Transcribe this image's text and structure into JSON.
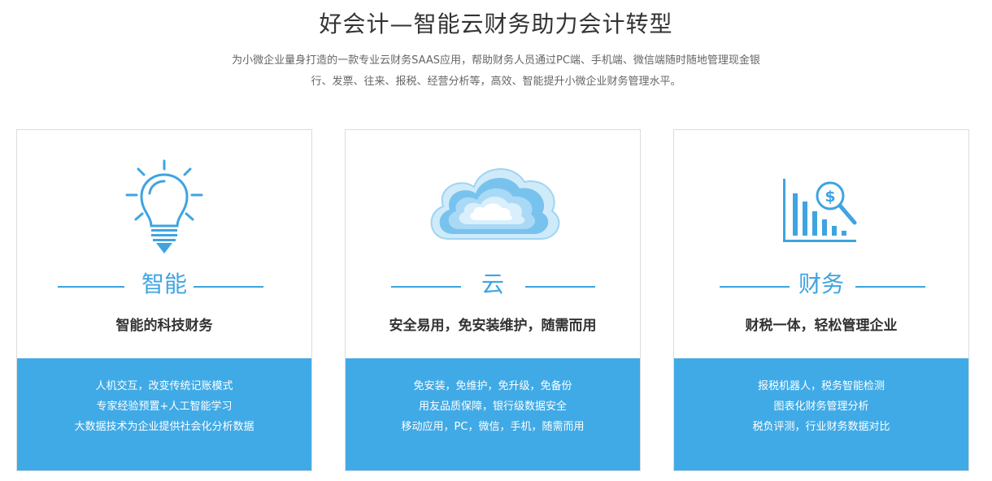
{
  "header": {
    "title": "好会计—智能云财务助力会计转型",
    "subtitle_line1": "为小微企业量身打造的一款专业云财务SAAS应用，帮助财务人员通过PC端、手机端、微信端随时随地管理现金银",
    "subtitle_line2": "行、发票、往来、报税、经营分析等，高效、智能提升小微企业财务管理水平。"
  },
  "cards": [
    {
      "icon": "lightbulb-icon",
      "heading": "智能",
      "tagline": "智能的科技财务",
      "features": [
        "人机交互，改变传统记账模式",
        "专家经验预置+人工智能学习",
        "大数据技术为企业提供社会化分析数据"
      ]
    },
    {
      "icon": "cloud-icon",
      "heading": "云",
      "tagline": "安全易用，免安装维护，随需而用",
      "features": [
        "免安装，免维护，免升级，免备份",
        "用友品质保障，银行级数据安全",
        "移动应用，PC，微信，手机，随需而用"
      ]
    },
    {
      "icon": "finance-chart-icon",
      "heading": "财务",
      "tagline": "财税一体，轻松管理企业",
      "features": [
        "报税机器人，税务智能检测",
        "图表化财务管理分析",
        "税负评测，行业财务数据对比"
      ]
    }
  ],
  "colors": {
    "accent": "#3fa4e0",
    "panel": "#40aae6",
    "border": "#dcdcdc"
  }
}
